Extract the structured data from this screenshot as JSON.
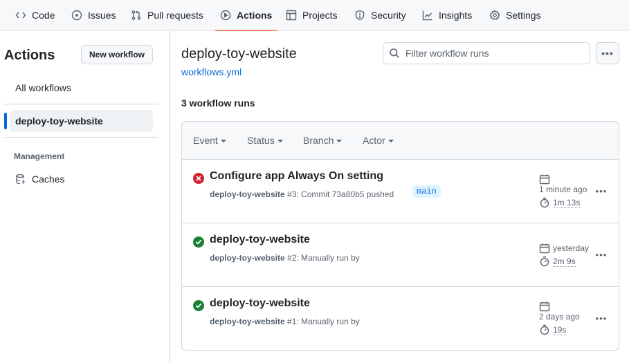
{
  "nav": {
    "tabs": [
      {
        "label": "Code",
        "icon": "code-icon",
        "active": false
      },
      {
        "label": "Issues",
        "icon": "issue-opened-icon",
        "active": false
      },
      {
        "label": "Pull requests",
        "icon": "git-pull-request-icon",
        "active": false
      },
      {
        "label": "Actions",
        "icon": "play-icon",
        "active": true
      },
      {
        "label": "Projects",
        "icon": "table-icon",
        "active": false
      },
      {
        "label": "Security",
        "icon": "shield-icon",
        "active": false
      },
      {
        "label": "Insights",
        "icon": "graph-icon",
        "active": false
      },
      {
        "label": "Settings",
        "icon": "gear-icon",
        "active": false
      }
    ],
    "active_color": "#fd8c73"
  },
  "sidebar": {
    "title": "Actions",
    "new_workflow_label": "New workflow",
    "all_workflows_label": "All workflows",
    "selected_workflow": "deploy-toy-website",
    "management_heading": "Management",
    "caches_label": "Caches"
  },
  "main": {
    "workflow_title": "deploy-toy-website",
    "workflow_file": "workflows.yml",
    "filter_placeholder": "Filter workflow runs",
    "more_label": "•••",
    "runs_count": "3 workflow runs",
    "filters": [
      "Event",
      "Status",
      "Branch",
      "Actor"
    ],
    "runs": [
      {
        "status": "failure",
        "title": "Configure app Always On setting",
        "workflow": "deploy-toy-website",
        "run_label": "#3: Commit 73a80b5 pushed",
        "branch": "main",
        "when": "1 minute ago",
        "duration": "1m 13s"
      },
      {
        "status": "success",
        "title": "deploy-toy-website",
        "workflow": "deploy-toy-website",
        "run_label": "#2: Manually run by",
        "branch": "",
        "when": "yesterday",
        "duration": "2m 9s"
      },
      {
        "status": "success",
        "title": "deploy-toy-website",
        "workflow": "deploy-toy-website",
        "run_label": "#1: Manually run by",
        "branch": "",
        "when": "2 days ago",
        "duration": "19s"
      }
    ],
    "colors": {
      "failure": "#cf222e",
      "success": "#1a7f37",
      "link": "#0969da"
    }
  }
}
